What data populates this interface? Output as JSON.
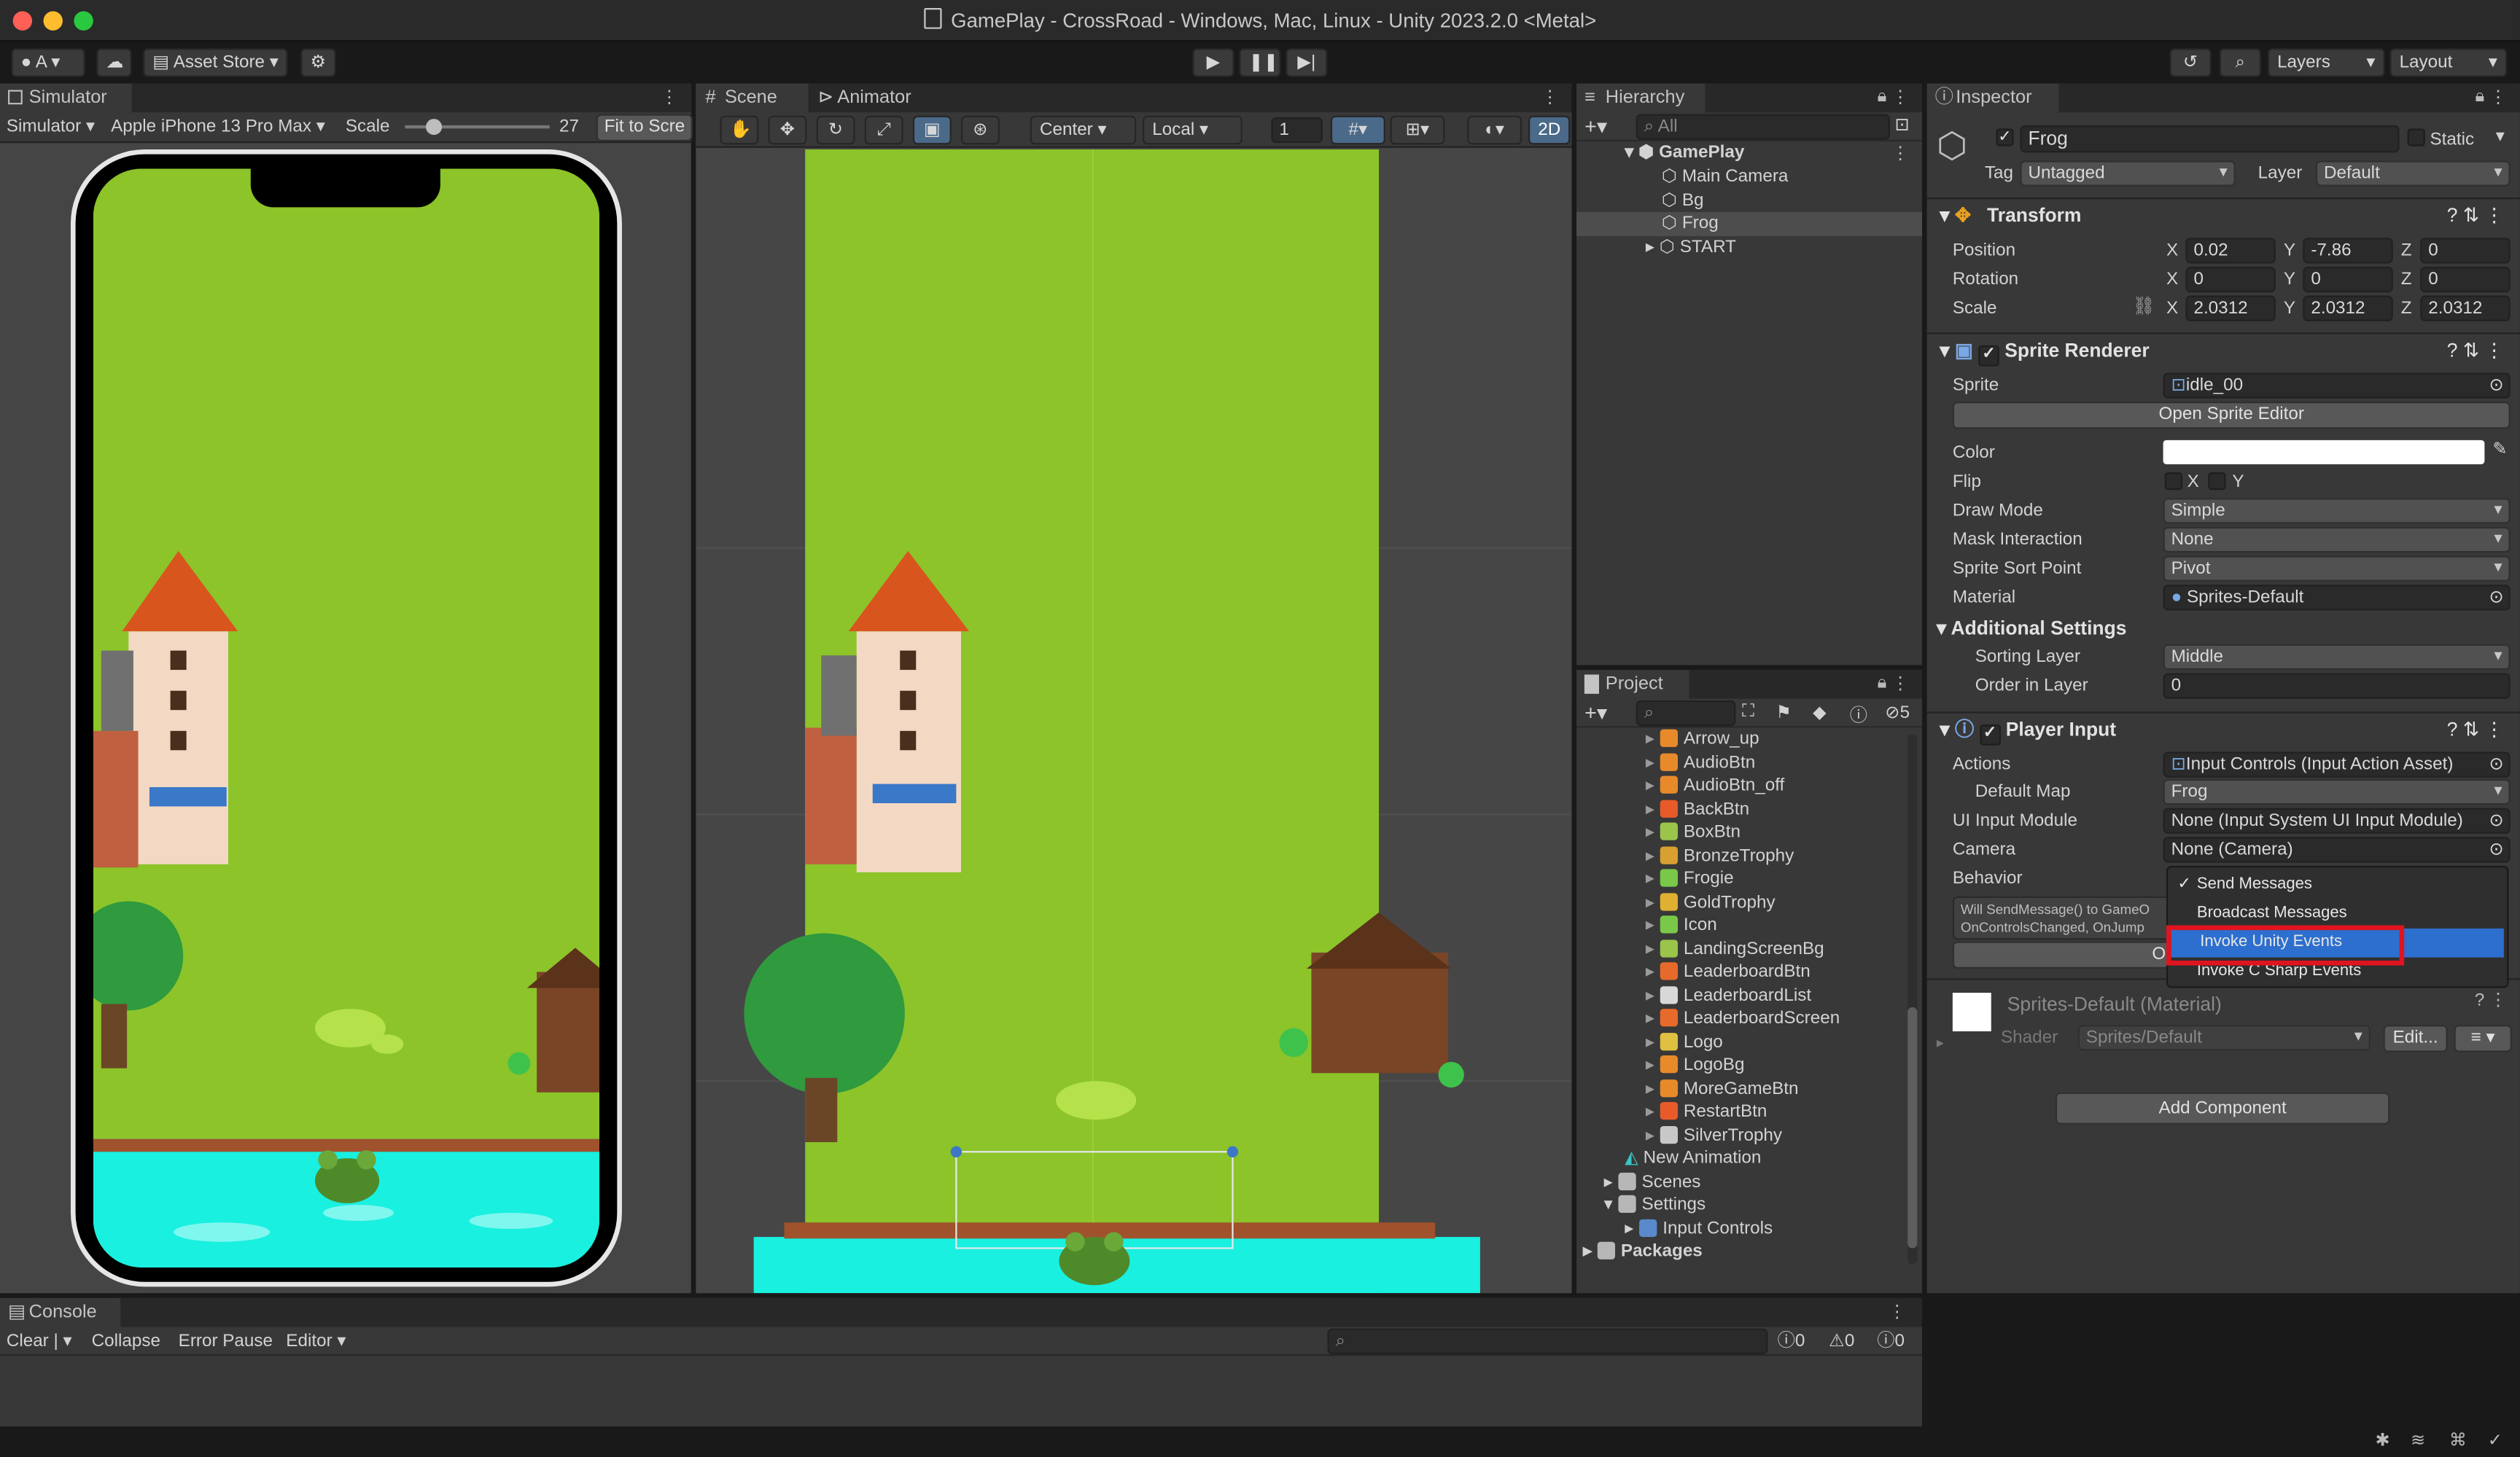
{
  "window": {
    "title": "GamePlay - CrossRoad - Windows, Mac, Linux - Unity 2023.2.0 <Metal>"
  },
  "toolbar": {
    "account": "A",
    "asset_store": "Asset Store",
    "layers": "Layers",
    "layout": "Layout"
  },
  "simulator": {
    "tab": "Simulator",
    "mode": "Simulator",
    "device": "Apple iPhone 13 Pro Max",
    "scale_label": "Scale",
    "scale_value": "27",
    "fit": "Fit to Scre"
  },
  "scene": {
    "tabs": [
      "Scene",
      "Animator"
    ],
    "pivot": "Center",
    "space": "Local",
    "snap": "1",
    "mode2d": "2D"
  },
  "hierarchy": {
    "tab": "Hierarchy",
    "search": "All",
    "root": "GamePlay",
    "items": [
      "Main Camera",
      "Bg",
      "Frog",
      "START"
    ]
  },
  "project": {
    "tab": "Project",
    "hidden_count": "5",
    "assets": [
      "Arrow_up",
      "AudioBtn",
      "AudioBtn_off",
      "BackBtn",
      "BoxBtn",
      "BronzeTrophy",
      "Frogie",
      "GoldTrophy",
      "Icon",
      "LandingScreenBg",
      "LeaderboardBtn",
      "LeaderboardList",
      "LeaderboardScreen",
      "Logo",
      "LogoBg",
      "MoreGameBtn",
      "RestartBtn",
      "SilverTrophy"
    ],
    "folders": [
      "New Animation",
      "Scenes",
      "Settings",
      "Input Controls",
      "Packages"
    ]
  },
  "inspector": {
    "tab": "Inspector",
    "object_name": "Frog",
    "static_label": "Static",
    "tag_label": "Tag",
    "tag_value": "Untagged",
    "layer_label": "Layer",
    "layer_value": "Default",
    "transform": {
      "title": "Transform",
      "position_label": "Position",
      "position": [
        "0.02",
        "-7.86",
        "0"
      ],
      "rotation_label": "Rotation",
      "rotation": [
        "0",
        "0",
        "0"
      ],
      "scale_label": "Scale",
      "scale": [
        "2.0312",
        "2.0312",
        "2.0312"
      ],
      "axes": [
        "X",
        "Y",
        "Z"
      ]
    },
    "sprite_renderer": {
      "title": "Sprite Renderer",
      "sprite_label": "Sprite",
      "sprite_value": "idle_00",
      "open_editor": "Open Sprite Editor",
      "color_label": "Color",
      "flip_label": "Flip",
      "flip_x": "X",
      "flip_y": "Y",
      "draw_mode_label": "Draw Mode",
      "draw_mode": "Simple",
      "mask_label": "Mask Interaction",
      "mask": "None",
      "sort_point_label": "Sprite Sort Point",
      "sort_point": "Pivot",
      "material_label": "Material",
      "material": "Sprites-Default",
      "additional": "Additional Settings",
      "sorting_layer_label": "Sorting Layer",
      "sorting_layer": "Middle",
      "order_label": "Order in Layer",
      "order": "0"
    },
    "player_input": {
      "title": "Player Input",
      "actions_label": "Actions",
      "actions": "Input Controls (Input Action Asset)",
      "default_map_label": "Default Map",
      "default_map": "Frog",
      "ui_module_label": "UI Input Module",
      "ui_module": "None (Input System UI Input Module)",
      "camera_label": "Camera",
      "camera": "None (Camera)",
      "behavior_label": "Behavior",
      "help_line1": "Will SendMessage() to GameO",
      "help_line2": "OnControlsChanged, OnJump",
      "open_settings": "Open Input Setting"
    },
    "behavior_menu": [
      "Send Messages",
      "Broadcast Messages",
      "Invoke Unity Events",
      "Invoke C Sharp Events"
    ],
    "behavior_selected": "Send Messages",
    "behavior_highlight": "Invoke Unity Events",
    "material_section": {
      "name": "Sprites-Default (Material)",
      "shader_label": "Shader",
      "shader": "Sprites/Default",
      "edit": "Edit..."
    },
    "add_component": "Add Component"
  },
  "console": {
    "tab": "Console",
    "clear": "Clear",
    "collapse": "Collapse",
    "error_pause": "Error Pause",
    "editor": "Editor",
    "counts": [
      "0",
      "0",
      "0"
    ]
  },
  "colors": {
    "highlight": "#2c5d87",
    "selection_blue": "#2d6fcf",
    "red_box": "#e0141e",
    "grass": "#8cc42a",
    "water": "#19f0e0"
  }
}
